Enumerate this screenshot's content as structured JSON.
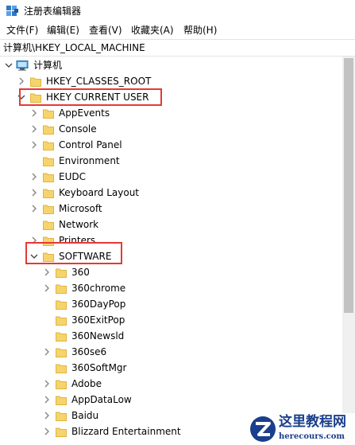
{
  "window": {
    "title": "注册表编辑器"
  },
  "menu": {
    "file": "文件(F)",
    "edit": "编辑(E)",
    "view": "查看(V)",
    "favorites": "收藏夹(A)",
    "help": "帮助(H)"
  },
  "address": {
    "path": "计算机\\HKEY_LOCAL_MACHINE"
  },
  "tree": {
    "root": "计算机",
    "hkcr": "HKEY_CLASSES_ROOT",
    "hkcu": "HKEY CURRENT USER",
    "hkcu_children": {
      "appevents": "AppEvents",
      "console": "Console",
      "control_panel": "Control Panel",
      "environment": "Environment",
      "eudc": "EUDC",
      "keyboard_layout": "Keyboard Layout",
      "microsoft": "Microsoft",
      "network": "Network",
      "printers": "Printers",
      "software": "SOFTWARE"
    },
    "software_children": {
      "k360": "360",
      "k360chrome": "360chrome",
      "k360daypop": "360DayPop",
      "k360exitpop": "360ExitPop",
      "k360newsld": "360Newsld",
      "k360se6": "360se6",
      "k360softmgr": "360SoftMgr",
      "adobe": "Adobe",
      "appdatalow": "AppDataLow",
      "baidu": "Baidu",
      "blizzard": "Blizzard Entertainment"
    }
  },
  "watermark": {
    "brand": "这里教程网",
    "url": "herecours.com"
  },
  "colors": {
    "highlight": "#e53935",
    "folder": "#f6d46c",
    "folder_dark": "#e0b441",
    "watermark": "#1a3f8c"
  }
}
